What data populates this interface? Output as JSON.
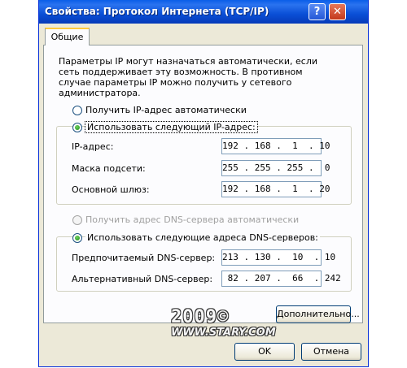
{
  "window": {
    "title": "Свойства: Протокол Интернета (TCP/IP)",
    "help_glyph": "?",
    "close_glyph": "✕"
  },
  "tabs": [
    {
      "label": "Общие",
      "selected": true
    }
  ],
  "general": {
    "intro": "Параметры IP могут назначаться автоматически, если сеть поддерживает эту возможность. В противном случае параметры IP можно получить у сетевого администратора.",
    "ip_auto": {
      "label": "Получить IP-адрес автоматически",
      "checked": false
    },
    "ip_manual": {
      "label": "Использовать следующий IP-адрес:",
      "checked": true
    },
    "ip_fields": {
      "ip": {
        "label": "IP-адрес:",
        "value": "192 . 168 .  1  . 10"
      },
      "mask": {
        "label": "Маска подсети:",
        "value": "255 . 255 . 255 .  0"
      },
      "gateway": {
        "label": "Основной шлюз:",
        "value": "192 . 168 .  1  . 20"
      }
    },
    "dns_auto": {
      "label": "Получить адрес DNS-сервера автоматически",
      "checked": false,
      "disabled": true
    },
    "dns_manual": {
      "label": "Использовать следующие адреса DNS-серверов:",
      "checked": true
    },
    "dns_fields": {
      "preferred": {
        "label": "Предпочитаемый DNS-сервер:",
        "value": "213 . 130 .  10  . 10"
      },
      "alternate": {
        "label": "Альтернативный DNS-сервер:",
        "value": " 82 . 207 .  66  . 242"
      }
    },
    "advanced_button": "Дополнительно..."
  },
  "buttons": {
    "ok": "OK",
    "cancel": "Отмена"
  },
  "watermark": {
    "year": "2009©",
    "site": "WWW.STARY.COM"
  }
}
